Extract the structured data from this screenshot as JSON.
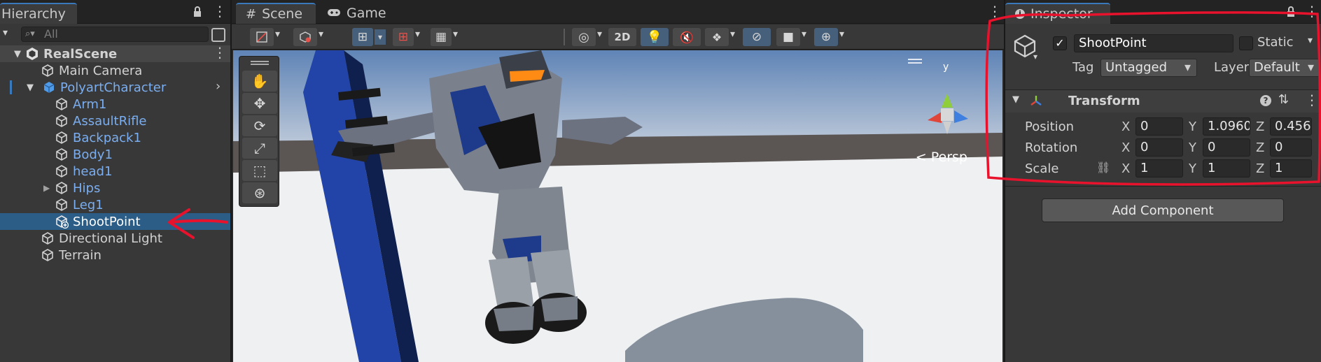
{
  "hierarchy": {
    "tab_label": "Hierarchy",
    "search_placeholder": "All",
    "scene_name": "RealScene",
    "items": [
      {
        "label": "Main Camera",
        "blue": false
      },
      {
        "label": "PolyartCharacter",
        "blue": true
      },
      {
        "label": "Arm1",
        "blue": true
      },
      {
        "label": "AssaultRifle",
        "blue": true
      },
      {
        "label": "Backpack1",
        "blue": true
      },
      {
        "label": "Body1",
        "blue": true
      },
      {
        "label": "head1",
        "blue": true
      },
      {
        "label": "Hips",
        "blue": true
      },
      {
        "label": "Leg1",
        "blue": true
      },
      {
        "label": "ShootPoint",
        "blue": false,
        "selected": true
      },
      {
        "label": "Directional Light",
        "blue": false
      },
      {
        "label": "Terrain",
        "blue": false
      }
    ]
  },
  "scene_view": {
    "tabs": [
      {
        "label": "Scene",
        "active": true
      },
      {
        "label": "Game",
        "active": false
      }
    ],
    "toolbar": {
      "mode_2d": "2D"
    },
    "camera_label": "Persp",
    "gizmo_axis_label": "y"
  },
  "inspector": {
    "tab_label": "Inspector",
    "object_name": "ShootPoint",
    "active_checked": true,
    "static_label": "Static",
    "tag_label": "Tag",
    "tag_value": "Untagged",
    "layer_label": "Layer",
    "layer_value": "Default",
    "component_title": "Transform",
    "position_label": "Position",
    "rotation_label": "Rotation",
    "scale_label": "Scale",
    "axis_x": "X",
    "axis_y": "Y",
    "axis_z": "Z",
    "position": {
      "x": "0",
      "y": "1.0960",
      "z": "0.4563"
    },
    "rotation": {
      "x": "0",
      "y": "0",
      "z": "0"
    },
    "scale": {
      "x": "1",
      "y": "1",
      "z": "1"
    },
    "add_component_label": "Add Component"
  },
  "colors": {
    "accent_selection": "#2c5d87",
    "annotation_red": "#e8122c",
    "prefab_blue": "#7aaef0"
  }
}
